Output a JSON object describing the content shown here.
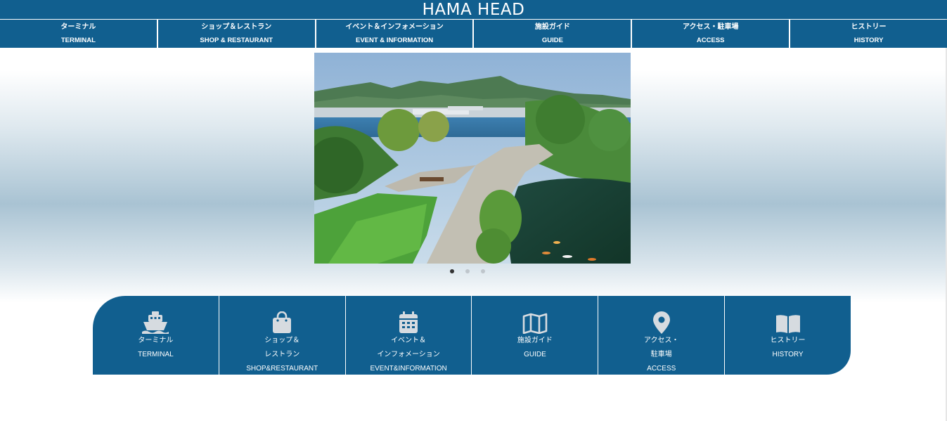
{
  "header": {
    "title": "HAMA HEAD"
  },
  "topnav": [
    {
      "jp": "ターミナル",
      "en": "TERMINAL"
    },
    {
      "jp": "ショップ＆レストラン",
      "en": "SHOP & RESTAURANT"
    },
    {
      "jp": "イベント＆インフォメーション",
      "en": "EVENT & INFORMATION"
    },
    {
      "jp": "施設ガイド",
      "en": "GUIDE"
    },
    {
      "jp": "アクセス・駐車場",
      "en": "ACCESS"
    },
    {
      "jp": "ヒストリー",
      "en": "HISTORY"
    }
  ],
  "carousel": {
    "slide_count": 3,
    "active_index": 0
  },
  "tiles": [
    {
      "icon": "ship-icon",
      "lines": [
        "ターミナル",
        "TERMINAL"
      ]
    },
    {
      "icon": "shopping-bag-icon",
      "lines": [
        "ショップ＆",
        "レストラン",
        "SHOP&RESTAURANT"
      ]
    },
    {
      "icon": "calendar-icon",
      "lines": [
        "イベント＆",
        "インフォメーション",
        "EVENT&INFORMATION"
      ]
    },
    {
      "icon": "map-icon",
      "lines": [
        "施設ガイド",
        "GUIDE"
      ]
    },
    {
      "icon": "location-pin-icon",
      "lines": [
        "アクセス・",
        "駐車場",
        "ACCESS"
      ]
    },
    {
      "icon": "book-icon",
      "lines": [
        "ヒストリー",
        "HISTORY"
      ]
    }
  ],
  "colors": {
    "brand": "#115f8f",
    "text_on_brand": "#ffffff"
  }
}
